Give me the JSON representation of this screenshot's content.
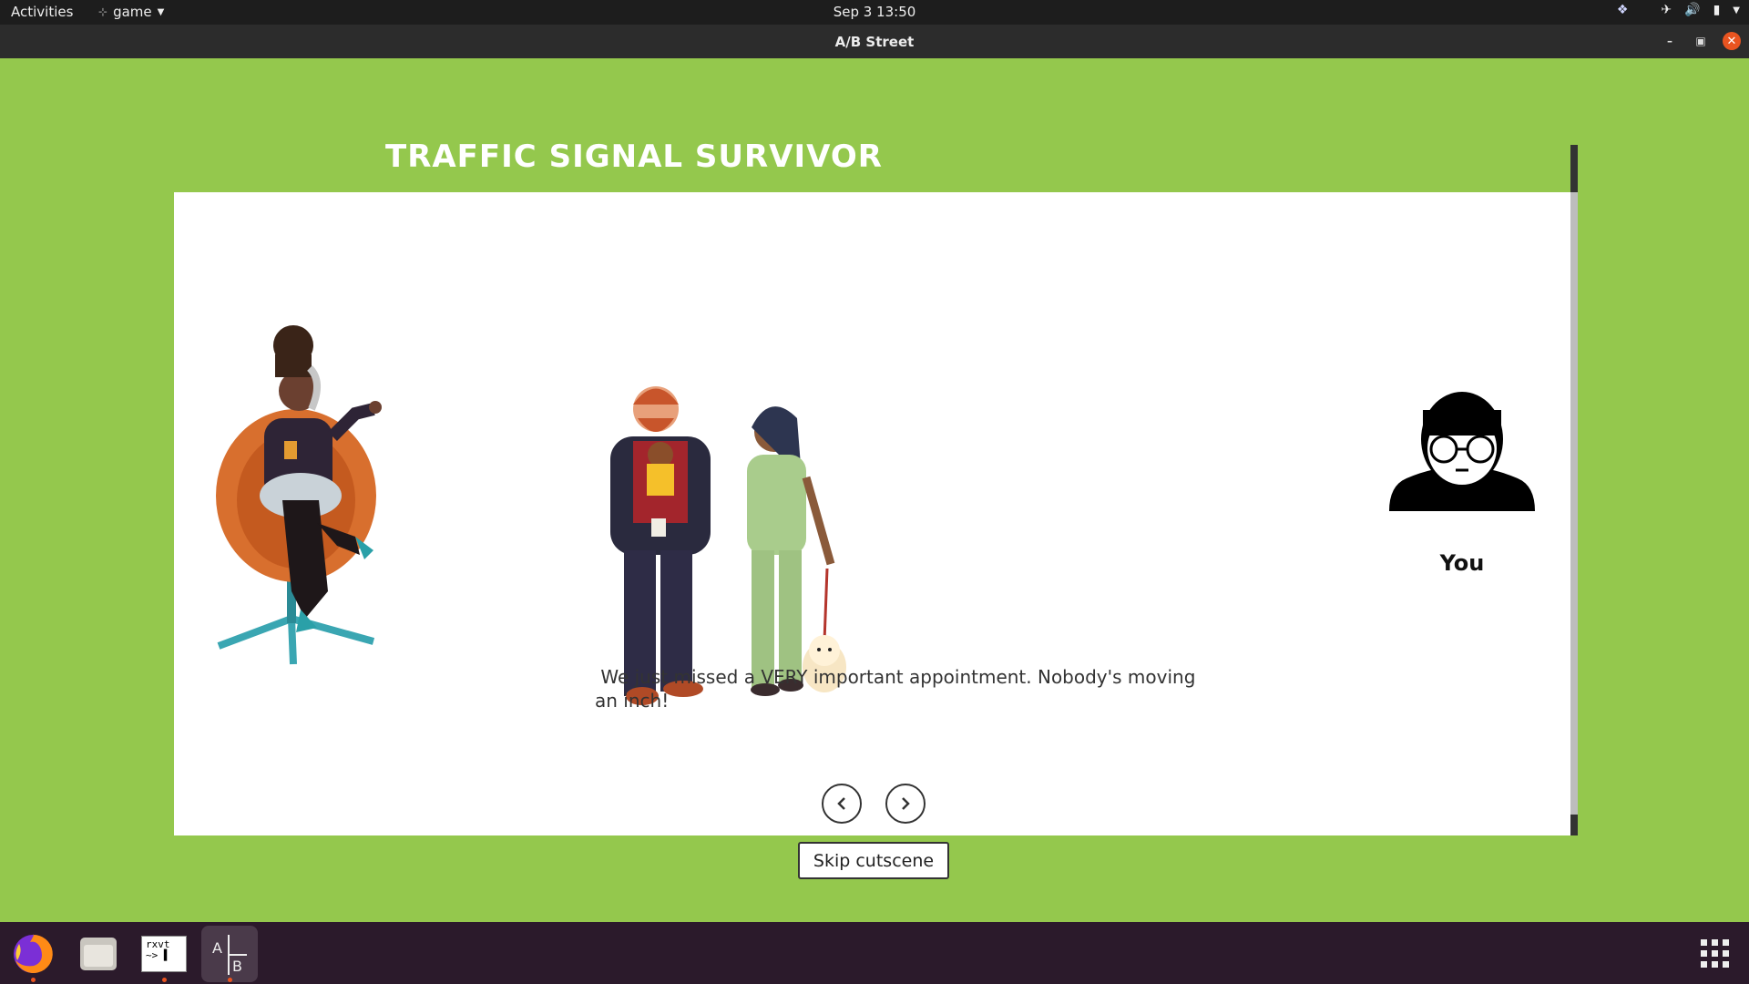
{
  "topbar": {
    "activities": "Activities",
    "app_menu": "game",
    "clock": "Sep 3  13:50"
  },
  "window": {
    "title": "A/B Street"
  },
  "game": {
    "title": "TRAFFIC SIGNAL SURVIVOR",
    "dialogue": " We just missed a VERY important appointment. Nobody's moving an inch!",
    "player_label": "You",
    "skip_label": "Skip cutscene"
  },
  "dock": {
    "terminal_text_line1": "rxvt",
    "terminal_text_line2": "~> ▌"
  },
  "colors": {
    "background": "#94c84d",
    "accent": "#e95420"
  }
}
